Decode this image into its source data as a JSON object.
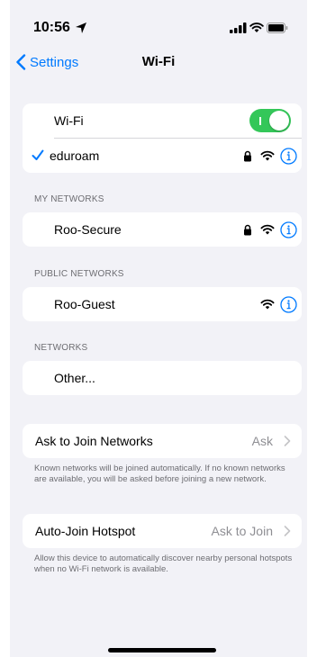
{
  "status_bar": {
    "time": "10:56",
    "icons": [
      "location-arrow-icon",
      "signal-bars-icon",
      "wifi-icon",
      "battery-icon"
    ]
  },
  "nav": {
    "back_label": "Settings",
    "title": "Wi-Fi"
  },
  "wifi_toggle": {
    "label": "Wi-Fi",
    "state": "on"
  },
  "connected_network": {
    "name": "eduroam",
    "secured": true,
    "selected": true
  },
  "my_networks": {
    "header": "MY NETWORKS",
    "items": [
      {
        "name": "Roo-Secure",
        "secured": true
      }
    ]
  },
  "public_networks": {
    "header": "PUBLIC NETWORKS",
    "items": [
      {
        "name": "Roo-Guest",
        "secured": false
      }
    ]
  },
  "networks": {
    "header": "NETWORKS",
    "other_label": "Other..."
  },
  "ask_to_join": {
    "label": "Ask to Join Networks",
    "value": "Ask",
    "footnote": "Known networks will be joined automatically. If no known networks are available, you will be asked before joining a new network."
  },
  "auto_join": {
    "label": "Auto-Join Hotspot",
    "value": "Ask to Join",
    "footnote": "Allow this device to automatically discover nearby personal hotspots when no Wi-Fi network is available."
  },
  "colors": {
    "accent": "#007aff",
    "toggle_on": "#34c759",
    "background": "#f2f2f7",
    "secondary_text": "#8e8e93"
  }
}
